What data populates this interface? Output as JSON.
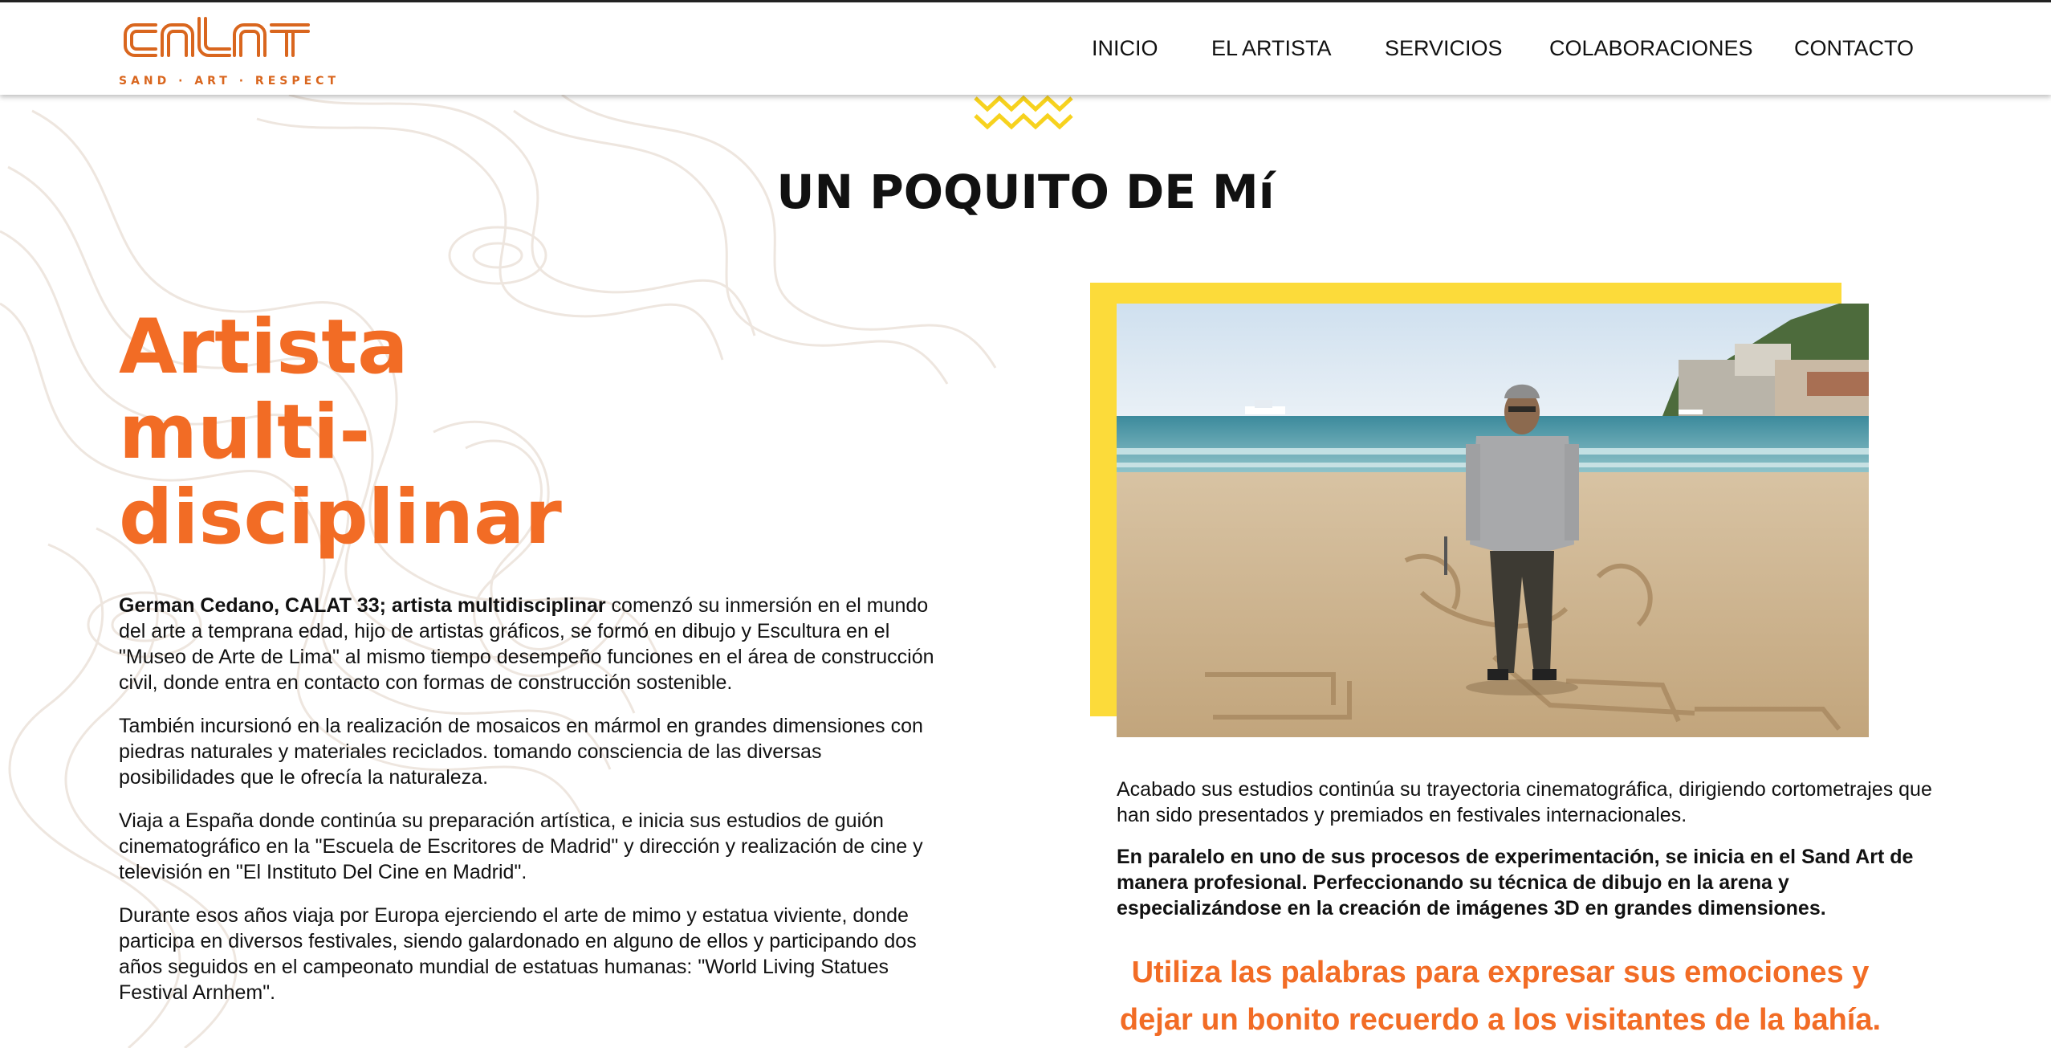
{
  "brand": {
    "logo_text": "CALAT",
    "tagline": "SAND · ART · RESPECT",
    "color": "#d9661e"
  },
  "nav": {
    "items": [
      "INICIO",
      "EL ARTISTA",
      "SERVICIOS",
      "COLABORACIONES",
      "CONTACTO"
    ]
  },
  "section": {
    "title": "UN POQUITO DE Mí"
  },
  "hero": {
    "lines": [
      "Artista",
      "multi-",
      "disciplinar"
    ],
    "color": "#f26c25"
  },
  "bio": {
    "p1_bold": "German Cedano, CALAT 33; artista multidisciplinar",
    "p1_rest": " comenzó su inmersión en el mundo del arte a temprana edad, hijo de artistas gráficos, se formó en dibujo y Escultura en el \"Museo de Arte de Lima\" al mismo tiempo desempeño funciones en el área de construcción civil, donde entra en contacto con formas de construcción sostenible.",
    "p2": "También incursionó en la realización de mosaicos en mármol en grandes dimensiones con piedras naturales y materiales reciclados. tomando consciencia de las diversas posibilidades que le ofrecía la naturaleza.",
    "p3": "Viaja a España donde continúa su preparación artística, e inicia sus estudios de guión cinematográfico en la \"Escuela de Escritores de Madrid\" y dirección y realización de cine y televisión en \"El Instituto Del Cine en Madrid\".",
    "p4": "Durante esos años viaja por Europa ejerciendo el arte de mimo y estatua viviente, donde participa en diversos festivales, siendo galardonado en alguno de ellos y participando dos años seguidos en el campeonato mundial de estatuas humanas: \"World Living Statues Festival Arnhem\"."
  },
  "right": {
    "p1": "Acabado sus estudios continúa su trayectoria cinematográfica, dirigiendo cortometrajes que han sido presentados y premiados en festivales internacionales.",
    "p2": "En paralelo en uno de sus procesos de experimentación, se inicia en el Sand Art de manera profesional. Perfeccionando su técnica de dibujo en la arena y especializándose en la creación de imágenes 3D en grandes dimensiones.",
    "quote_lines": [
      "Utiliza las palabras para expresar sus emociones y",
      "dejar un bonito recuerdo a los visitantes de la bahía."
    ]
  },
  "colors": {
    "accent_orange": "#f26c25",
    "frame_yellow": "#fcdb3a",
    "zigzag_yellow": "#f7d21e"
  }
}
